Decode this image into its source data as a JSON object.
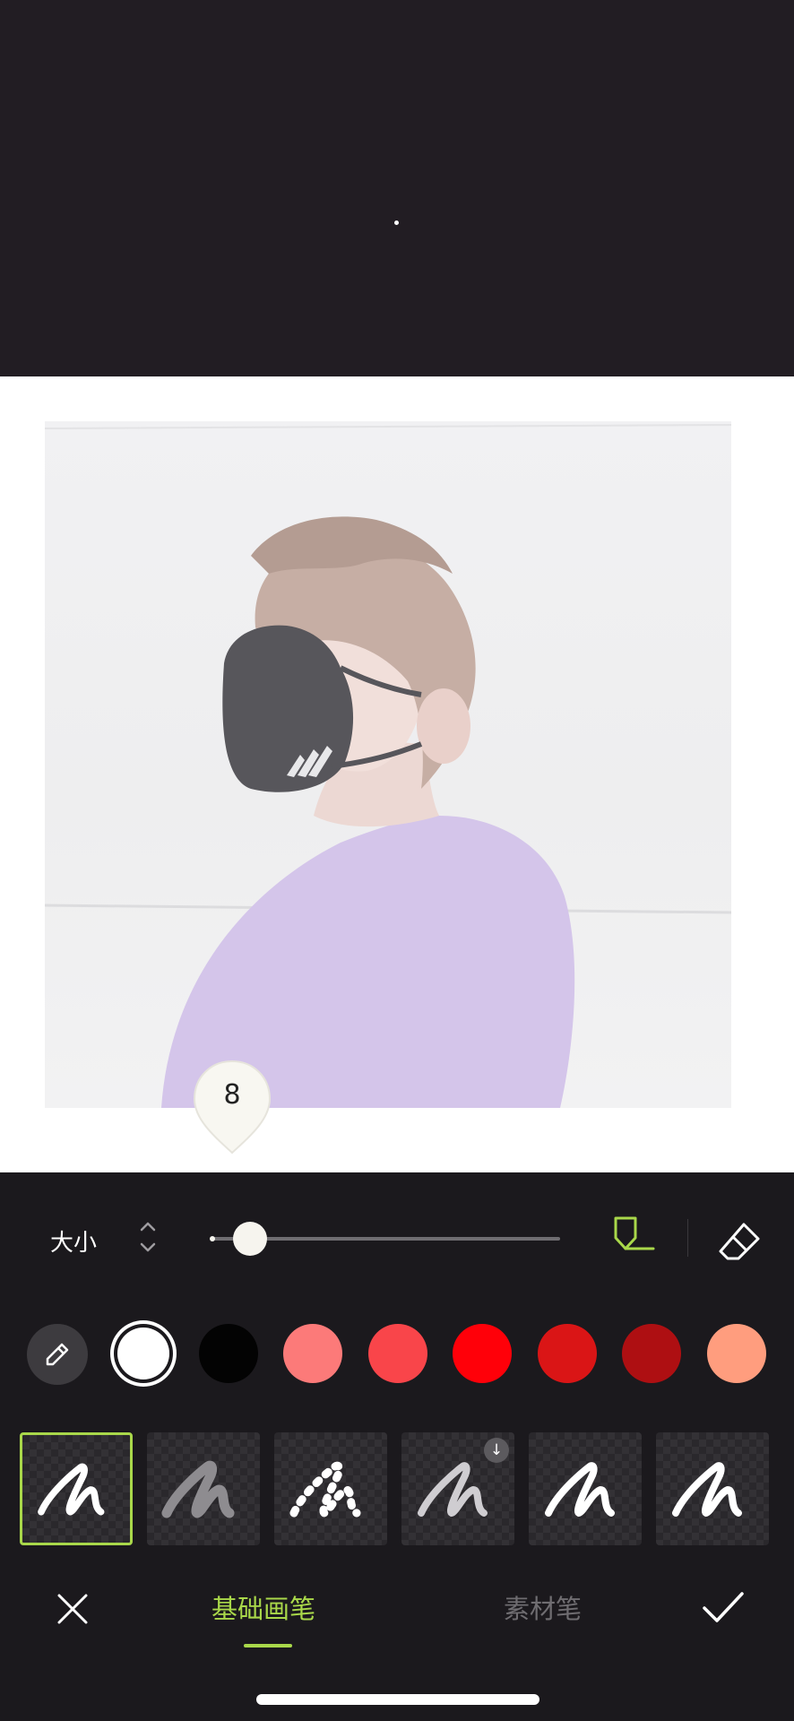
{
  "editor": {
    "size_value": "8",
    "size_label": "大小",
    "size_fraction": 0.05
  },
  "colors": {
    "accent": "#a9d84a",
    "swatches": [
      "#ffffff",
      "#030303",
      "#fc7a79",
      "#f9454a",
      "#ff0009",
      "#da1516",
      "#ae0f12",
      "#ff9d7e"
    ],
    "selected_swatch": "#ffffff"
  },
  "icons": {
    "size_stepper": "chevron-up-down-icon",
    "pen_mode": "pen-marker-icon",
    "eraser": "eraser-icon",
    "color_picker": "eyedropper-icon",
    "close": "close-icon",
    "confirm": "checkmark-icon",
    "download": "download-icon"
  },
  "brushes": [
    {
      "style": "solid",
      "selected": true
    },
    {
      "style": "glitter",
      "selected": false
    },
    {
      "style": "dotted",
      "selected": false
    },
    {
      "style": "textured",
      "selected": false,
      "download": true
    },
    {
      "style": "solid",
      "selected": false
    },
    {
      "style": "solid",
      "selected": false
    }
  ],
  "tabs": {
    "basic": "基础画笔",
    "material": "素材笔",
    "active": "basic"
  }
}
